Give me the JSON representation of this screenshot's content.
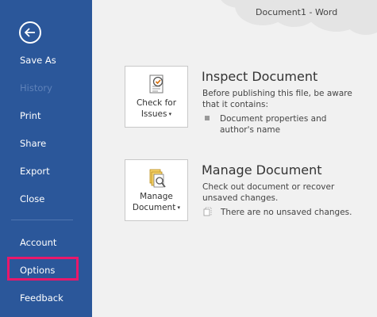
{
  "window": {
    "title": "Document1 - Word"
  },
  "sidebar": {
    "back_icon": "back-arrow-icon",
    "items": [
      {
        "label": "Save As"
      },
      {
        "label": "History"
      },
      {
        "label": "Print"
      },
      {
        "label": "Share"
      },
      {
        "label": "Export"
      },
      {
        "label": "Close"
      },
      {
        "label": "Account"
      },
      {
        "label": "Options"
      },
      {
        "label": "Feedback"
      }
    ],
    "highlighted_item": "Options",
    "disabled_item": "History",
    "background_color": "#2b579a",
    "highlight_color": "#e8186b"
  },
  "inspect": {
    "button_line1": "Check for",
    "button_line2": "Issues",
    "title": "Inspect Document",
    "description": "Before publishing this file, be aware that it contains:",
    "bullet": "Document properties and author's name"
  },
  "manage": {
    "button_line1": "Manage",
    "button_line2": "Document",
    "title": "Manage Document",
    "description": "Check out document or recover unsaved changes.",
    "bullet": "There are no unsaved changes."
  }
}
